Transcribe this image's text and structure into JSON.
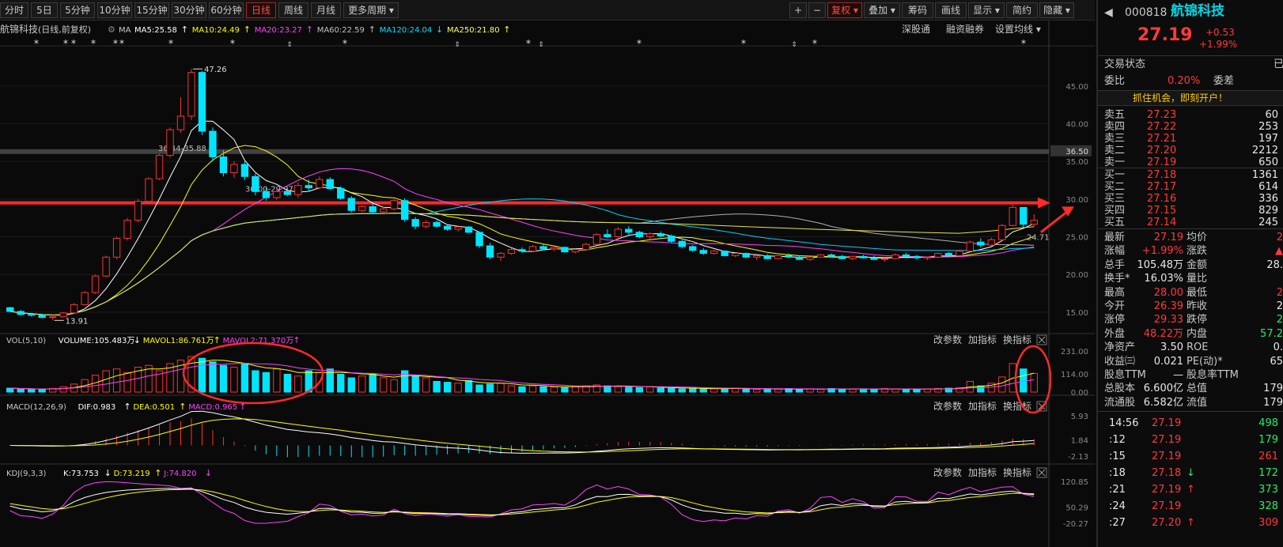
{
  "toolbar": {
    "periods": [
      "分时",
      "5日",
      "5分钟",
      "10分钟",
      "15分钟",
      "30分钟",
      "60分钟",
      "日线",
      "周线",
      "月线",
      "更多周期"
    ],
    "active_period": "日线",
    "tools": [
      "+",
      "−",
      "复权",
      "叠加",
      "筹码",
      "画线",
      "显示",
      "简约",
      "隐藏"
    ]
  },
  "header": {
    "stock_label": "航锦科技",
    "mode": "(日线,前复权)",
    "ma_prefix": "MA",
    "ma_items": [
      {
        "label": "MA5:25.58",
        "arrow": "↑",
        "color": "#ffffff"
      },
      {
        "label": "MA10:24.49",
        "arrow": "↑",
        "color": "#ffff00"
      },
      {
        "label": "MA20:23.27",
        "arrow": "↑",
        "color": "#ff40ff"
      },
      {
        "label": "MA60:22.59",
        "arrow": "↑",
        "color": "#c0c0c0"
      },
      {
        "label": "MA120:24.04",
        "arrow": "↓",
        "color": "#00e0ff"
      },
      {
        "label": "MA250:21.80",
        "arrow": "↑",
        "color": "#ffff60"
      }
    ],
    "links": [
      "深股通",
      "融资融券",
      "设置均线"
    ]
  },
  "panel_links": [
    "改参数",
    "加指标",
    "换指标"
  ],
  "vol_header": [
    {
      "label": "VOL(5,10)",
      "color": "#c8c8c8"
    },
    {
      "label": "VOLUME:105.483万",
      "arrow": "↓",
      "color": "#ffffff"
    },
    {
      "label": "MAVOL1:86.761万",
      "arrow": "↑",
      "color": "#ffff00"
    },
    {
      "label": "MAVOL2:71.370万",
      "arrow": "↑",
      "color": "#ff40ff"
    }
  ],
  "macd_header": [
    {
      "label": "MACD(12,26,9)",
      "color": "#c8c8c8"
    },
    {
      "label": "DIF:0.983",
      "arrow": "↑",
      "color": "#ffffff"
    },
    {
      "label": "DEA:0.501",
      "arrow": "↑",
      "color": "#ffff00"
    },
    {
      "label": "MACD:0.965",
      "arrow": "↑",
      "color": "#ff40ff"
    }
  ],
  "kdj_header": [
    {
      "label": "KDJ(9,3,3)",
      "color": "#c8c8c8"
    },
    {
      "label": "K:73.753",
      "arrow": "↓",
      "color": "#ffffff"
    },
    {
      "label": "D:73.219",
      "arrow": "↑",
      "color": "#ffff00"
    },
    {
      "label": "J:74.820",
      "arrow": "↓",
      "color": "#ff40ff"
    }
  ],
  "chart_data": {
    "type": "candlestick",
    "price_axis": {
      "ticks": [
        45.0,
        40.0,
        35.0,
        30.0,
        25.0,
        20.0,
        15.0
      ],
      "tick_labels": [
        "45.00",
        "40.00",
        "35.00",
        "30.00",
        "25.00",
        "20.00",
        "15.00"
      ],
      "range": [
        13.0,
        47.6
      ]
    },
    "annotations": {
      "high_label": "47.26",
      "low_label": "13.91",
      "band_label": "36.44-35.88",
      "band_price_label": "36.50",
      "line_label": "30.00-29.97",
      "ma_end_label": "24.71"
    },
    "candles_ohlc": [
      [
        15.6,
        15.7,
        15.0,
        15.1
      ],
      [
        15.1,
        15.3,
        14.6,
        14.7
      ],
      [
        14.7,
        14.9,
        14.4,
        14.6
      ],
      [
        14.6,
        14.8,
        14.2,
        14.3
      ],
      [
        14.3,
        14.6,
        13.91,
        14.4
      ],
      [
        14.4,
        15.0,
        14.3,
        14.9
      ],
      [
        14.9,
        16.2,
        14.8,
        16.0
      ],
      [
        16.0,
        17.8,
        15.9,
        17.6
      ],
      [
        17.6,
        20.0,
        17.4,
        19.8
      ],
      [
        19.8,
        22.5,
        19.6,
        22.3
      ],
      [
        22.3,
        25.0,
        22.0,
        24.8
      ],
      [
        24.8,
        27.5,
        24.5,
        27.2
      ],
      [
        27.2,
        30.0,
        26.9,
        29.7
      ],
      [
        29.7,
        32.9,
        29.5,
        32.7
      ],
      [
        32.7,
        36.0,
        32.5,
        35.8
      ],
      [
        35.8,
        39.5,
        35.5,
        39.2
      ],
      [
        39.2,
        43.5,
        38.8,
        41.0
      ],
      [
        41.0,
        47.26,
        40.5,
        46.8
      ],
      [
        46.8,
        47.0,
        38.5,
        39.0
      ],
      [
        39.0,
        39.5,
        35.0,
        35.6
      ],
      [
        35.6,
        36.5,
        33.0,
        33.5
      ],
      [
        33.5,
        35.0,
        32.8,
        34.6
      ],
      [
        34.6,
        35.0,
        32.5,
        33.0
      ],
      [
        33.0,
        33.4,
        30.5,
        31.0
      ],
      [
        31.0,
        31.5,
        29.8,
        30.2
      ],
      [
        30.2,
        31.3,
        29.9,
        31.0
      ],
      [
        31.0,
        31.6,
        30.4,
        30.6
      ],
      [
        30.6,
        32.2,
        30.2,
        31.8
      ],
      [
        31.8,
        32.6,
        31.0,
        31.5
      ],
      [
        31.5,
        33.0,
        31.3,
        32.6
      ],
      [
        32.6,
        32.9,
        31.2,
        31.4
      ],
      [
        31.4,
        31.7,
        29.9,
        30.1
      ],
      [
        30.1,
        30.4,
        28.2,
        28.5
      ],
      [
        28.5,
        29.2,
        28.3,
        29.0
      ],
      [
        29.0,
        29.4,
        28.0,
        28.3
      ],
      [
        28.3,
        29.0,
        28.1,
        28.7
      ],
      [
        28.7,
        30.0,
        28.5,
        29.8
      ],
      [
        29.8,
        30.1,
        27.0,
        27.3
      ],
      [
        27.3,
        27.6,
        26.0,
        26.4
      ],
      [
        26.4,
        27.2,
        26.1,
        26.9
      ],
      [
        26.9,
        27.2,
        26.2,
        26.4
      ],
      [
        26.4,
        26.6,
        25.8,
        26.0
      ],
      [
        26.0,
        26.5,
        25.7,
        26.3
      ],
      [
        26.3,
        26.4,
        25.5,
        25.6
      ],
      [
        25.6,
        25.7,
        23.5,
        23.8
      ],
      [
        23.8,
        24.2,
        22.0,
        22.3
      ],
      [
        22.3,
        23.0,
        21.8,
        22.8
      ],
      [
        22.8,
        23.5,
        22.6,
        23.3
      ],
      [
        23.3,
        23.6,
        22.9,
        23.1
      ],
      [
        23.1,
        23.9,
        23.0,
        23.7
      ],
      [
        23.7,
        24.0,
        23.2,
        23.4
      ],
      [
        23.4,
        23.8,
        23.1,
        23.6
      ],
      [
        23.6,
        23.7,
        22.9,
        23.0
      ],
      [
        23.0,
        23.4,
        22.8,
        23.3
      ],
      [
        23.3,
        24.2,
        23.2,
        24.0
      ],
      [
        24.0,
        25.5,
        23.9,
        25.3
      ],
      [
        25.3,
        26.0,
        24.8,
        25.0
      ],
      [
        25.0,
        26.3,
        24.9,
        26.0
      ],
      [
        26.0,
        26.4,
        25.3,
        25.6
      ],
      [
        25.6,
        25.8,
        24.8,
        25.0
      ],
      [
        25.0,
        25.6,
        24.6,
        25.4
      ],
      [
        25.4,
        25.7,
        24.9,
        25.1
      ],
      [
        25.1,
        25.3,
        24.2,
        24.4
      ],
      [
        24.4,
        24.6,
        23.5,
        23.7
      ],
      [
        23.7,
        23.9,
        23.0,
        23.2
      ],
      [
        23.2,
        23.5,
        22.6,
        22.8
      ],
      [
        22.8,
        23.3,
        22.6,
        23.1
      ],
      [
        23.1,
        23.2,
        22.4,
        22.5
      ],
      [
        22.5,
        22.9,
        22.3,
        22.8
      ],
      [
        22.8,
        22.9,
        22.2,
        22.3
      ],
      [
        22.3,
        22.6,
        21.9,
        22.5
      ],
      [
        22.5,
        22.7,
        22.0,
        22.1
      ],
      [
        22.1,
        22.6,
        22.0,
        22.5
      ],
      [
        22.5,
        22.8,
        22.2,
        22.3
      ],
      [
        22.3,
        22.5,
        21.9,
        22.0
      ],
      [
        22.0,
        22.4,
        21.8,
        22.3
      ],
      [
        22.3,
        22.7,
        22.2,
        22.6
      ],
      [
        22.6,
        22.8,
        22.3,
        22.4
      ],
      [
        22.4,
        22.6,
        22.0,
        22.1
      ],
      [
        22.1,
        22.5,
        21.9,
        22.4
      ],
      [
        22.4,
        22.6,
        22.1,
        22.2
      ],
      [
        22.2,
        22.5,
        21.9,
        22.0
      ],
      [
        22.0,
        22.2,
        21.7,
        22.1
      ],
      [
        22.1,
        22.8,
        22.0,
        22.6
      ],
      [
        22.6,
        22.9,
        22.3,
        22.4
      ],
      [
        22.4,
        22.6,
        22.0,
        22.2
      ],
      [
        22.2,
        22.4,
        21.9,
        22.3
      ],
      [
        22.3,
        22.9,
        22.2,
        22.8
      ],
      [
        22.8,
        23.0,
        22.4,
        22.5
      ],
      [
        22.5,
        23.3,
        22.4,
        23.1
      ],
      [
        23.1,
        24.5,
        23.0,
        24.3
      ],
      [
        24.3,
        24.8,
        23.6,
        23.9
      ],
      [
        23.9,
        24.9,
        23.8,
        24.6
      ],
      [
        24.6,
        26.7,
        24.5,
        26.5
      ],
      [
        26.5,
        29.33,
        26.39,
        28.9
      ],
      [
        28.9,
        28.9,
        26.2,
        26.66
      ],
      [
        26.66,
        28.0,
        26.39,
        27.19
      ]
    ],
    "volume_axis": {
      "tick_labels": [
        "231.00",
        "114.00",
        "0.00"
      ],
      "range": [
        0,
        231
      ]
    },
    "volume": [
      22,
      18,
      15,
      14,
      20,
      30,
      45,
      70,
      95,
      120,
      130,
      110,
      140,
      150,
      120,
      160,
      180,
      200,
      190,
      170,
      150,
      140,
      160,
      120,
      110,
      130,
      100,
      90,
      120,
      110,
      130,
      100,
      80,
      90,
      100,
      80,
      70,
      120,
      90,
      80,
      60,
      55,
      50,
      65,
      40,
      45,
      50,
      35,
      30,
      35,
      30,
      28,
      25,
      30,
      35,
      40,
      35,
      30,
      28,
      25,
      30,
      22,
      20,
      18,
      22,
      20,
      18,
      20,
      22,
      18,
      15,
      18,
      16,
      20,
      15,
      18,
      16,
      20,
      18,
      16,
      18,
      15,
      20,
      18,
      16,
      15,
      18,
      20,
      22,
      25,
      60,
      35,
      50,
      85,
      160,
      130,
      105
    ],
    "volume_up": [
      false,
      false,
      false,
      false,
      true,
      true,
      true,
      true,
      true,
      true,
      true,
      true,
      true,
      true,
      true,
      true,
      true,
      true,
      false,
      false,
      false,
      true,
      false,
      false,
      false,
      true,
      false,
      true,
      false,
      true,
      false,
      false,
      false,
      true,
      false,
      true,
      true,
      false,
      false,
      true,
      false,
      false,
      true,
      false,
      false,
      false,
      true,
      true,
      false,
      true,
      false,
      true,
      false,
      true,
      true,
      true,
      false,
      true,
      false,
      false,
      true,
      false,
      false,
      false,
      false,
      false,
      true,
      false,
      true,
      false,
      true,
      false,
      true,
      false,
      false,
      true,
      true,
      false,
      false,
      true,
      false,
      false,
      true,
      true,
      false,
      false,
      true,
      true,
      false,
      true,
      true,
      false,
      true,
      true,
      true,
      false,
      true
    ],
    "macd_axis": {
      "tick_labels": [
        "5.93",
        "1.84",
        "-2.13"
      ],
      "range": [
        -2.13,
        5.93
      ]
    },
    "kdj_axis": {
      "tick_labels": [
        "120.85",
        "50.29",
        "-20.27"
      ],
      "range": [
        -20.27,
        120.85
      ]
    }
  },
  "side": {
    "code": "000818",
    "name": "航锦科技",
    "price": "27.19",
    "change": "+0.53",
    "change_pct": "+1.99%",
    "status_label": "交易状态",
    "status_tail": "已",
    "weibi_label": "委比",
    "weibi_value": "0.20%",
    "weicha_label": "委差",
    "banner": "抓住机会，即刻开户！",
    "asks": [
      {
        "label": "卖五",
        "price": "27.23",
        "vol": "60"
      },
      {
        "label": "卖四",
        "price": "27.22",
        "vol": "253"
      },
      {
        "label": "卖三",
        "price": "27.21",
        "vol": "197"
      },
      {
        "label": "卖二",
        "price": "27.20",
        "vol": "2212"
      },
      {
        "label": "卖一",
        "price": "27.19",
        "vol": "650"
      }
    ],
    "bids": [
      {
        "label": "买一",
        "price": "27.18",
        "vol": "1361"
      },
      {
        "label": "买二",
        "price": "27.17",
        "vol": "614"
      },
      {
        "label": "买三",
        "price": "27.16",
        "vol": "336"
      },
      {
        "label": "买四",
        "price": "27.15",
        "vol": "829"
      },
      {
        "label": "买五",
        "price": "27.14",
        "vol": "245"
      }
    ],
    "stats": [
      {
        "l1": "最新",
        "v1": "27.19",
        "c1": "red",
        "l2": "均价",
        "v2": "2",
        "c2": "red"
      },
      {
        "l1": "涨幅",
        "v1": "+1.99%",
        "c1": "red",
        "l2": "涨跌",
        "v2": "▲",
        "c2": "red"
      },
      {
        "l1": "总手",
        "v1": "105.48万",
        "c1": "white",
        "l2": "金额",
        "v2": "28.",
        "c2": "white"
      },
      {
        "l1": "换手*",
        "v1": "16.03%",
        "c1": "white",
        "l2": "量比",
        "v2": "",
        "c2": "white"
      },
      {
        "l1": "最高",
        "v1": "28.00",
        "c1": "red",
        "l2": "最低",
        "v2": "2",
        "c2": "red"
      },
      {
        "l1": "今开",
        "v1": "26.39",
        "c1": "red",
        "l2": "昨收",
        "v2": "2",
        "c2": "white"
      },
      {
        "l1": "涨停",
        "v1": "29.33",
        "c1": "red",
        "l2": "跌停",
        "v2": "2",
        "c2": "green"
      },
      {
        "l1": "外盘",
        "v1": "48.22万",
        "c1": "red",
        "l2": "内盘",
        "v2": "57.2",
        "c2": "green"
      },
      {
        "l1": "净资产",
        "v1": "3.50",
        "c1": "white",
        "l2": "ROE",
        "v2": "0.",
        "c2": "white"
      },
      {
        "l1": "收益㈢",
        "v1": "0.021",
        "c1": "white",
        "l2": "PE(动)*",
        "v2": "65",
        "c2": "white"
      },
      {
        "l1": "股息TTM",
        "v1": "—",
        "c1": "white",
        "l2": "股息率TTM",
        "v2": "",
        "c2": "white"
      },
      {
        "l1": "总股本",
        "v1": "6.600亿",
        "c1": "white",
        "l2": "总值",
        "v2": "179",
        "c2": "white"
      },
      {
        "l1": "流通股",
        "v1": "6.582亿",
        "c1": "white",
        "l2": "流值",
        "v2": "179",
        "c2": "white"
      }
    ],
    "ticks": [
      {
        "time": "14:56",
        "price": "27.19",
        "vol": "498",
        "arrow": "",
        "vc": "green"
      },
      {
        "time": ":12",
        "price": "27.19",
        "vol": "179",
        "arrow": "",
        "vc": "green"
      },
      {
        "time": ":15",
        "price": "27.19",
        "vol": "261",
        "arrow": "",
        "vc": "red"
      },
      {
        "time": ":18",
        "price": "27.18",
        "vol": "172",
        "arrow": "↓",
        "vc": "green"
      },
      {
        "time": ":21",
        "price": "27.19",
        "vol": "373",
        "arrow": "↑",
        "vc": "green"
      },
      {
        "time": ":24",
        "price": "27.19",
        "vol": "328",
        "arrow": "",
        "vc": "green"
      },
      {
        "time": ":27",
        "price": "27.20",
        "vol": "309",
        "arrow": "↑",
        "vc": "red"
      }
    ]
  }
}
